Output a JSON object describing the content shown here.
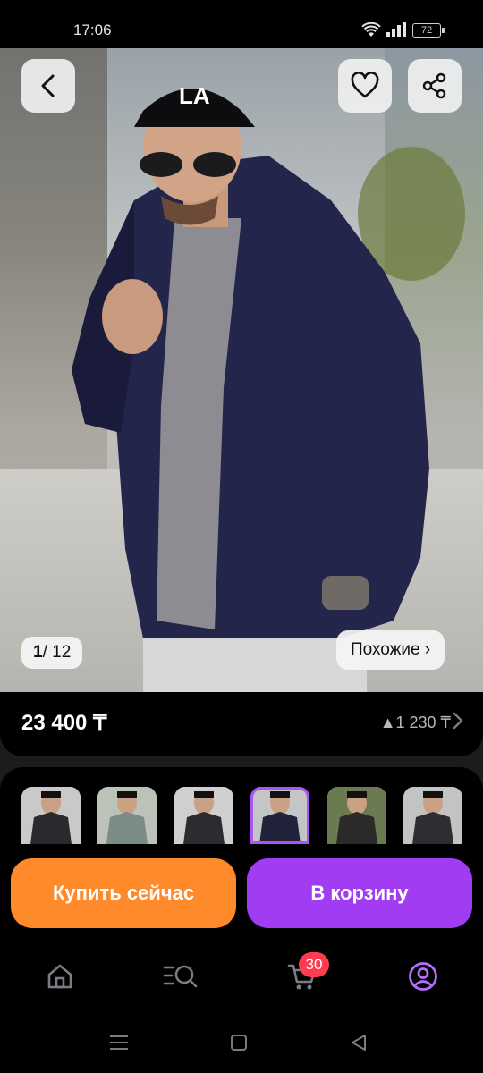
{
  "status_bar": {
    "time": "17:06",
    "battery": "72"
  },
  "gallery": {
    "index": "1",
    "total": "12",
    "similar_label": "Похожие ›"
  },
  "product": {
    "price": "23 400 ₸",
    "bonus": "▲1 230 ₸"
  },
  "thumbnails": [
    {
      "jacket": "#2a2a2e"
    },
    {
      "jacket": "#7b8c86"
    },
    {
      "jacket": "#2b2b30"
    },
    {
      "jacket": "#22233b",
      "selected": true
    },
    {
      "jacket": "#2a2a2a"
    },
    {
      "jacket": "#2d2d33"
    }
  ],
  "actions": {
    "buy_now": "Купить сейчас",
    "add_to_cart": "В корзину"
  },
  "bottom_nav": {
    "cart_count": "30"
  },
  "colors": {
    "accent": "#a23cf2",
    "buy": "#ff8a2b",
    "badge": "#ff3b4f"
  }
}
